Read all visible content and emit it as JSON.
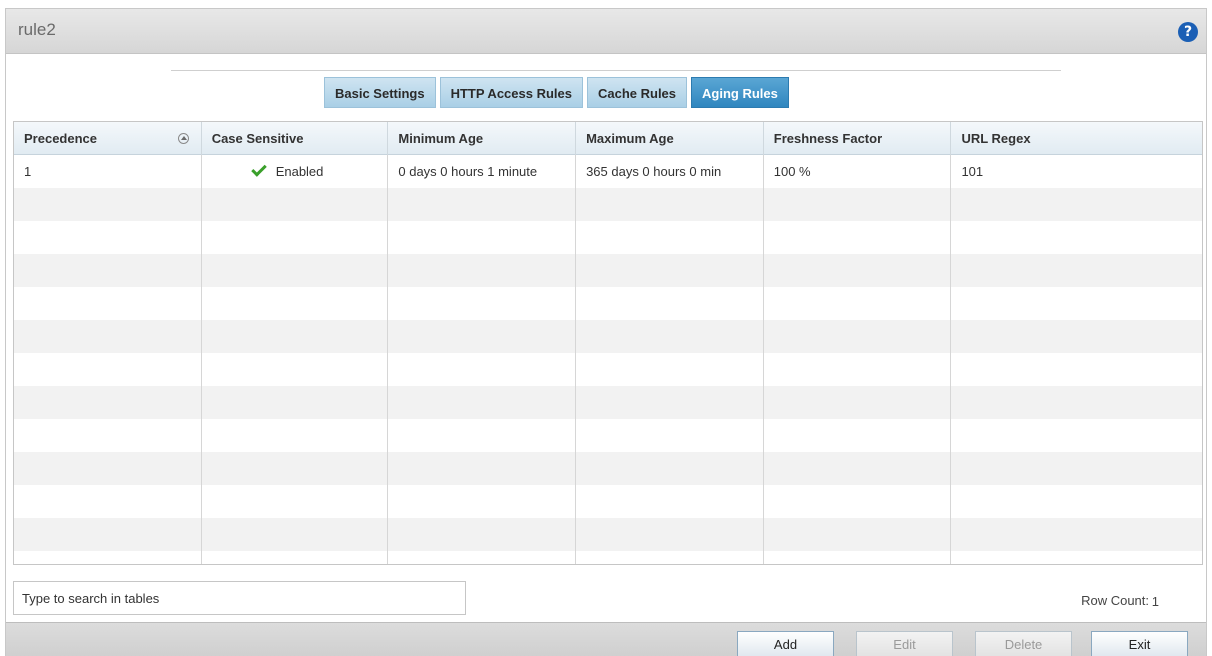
{
  "window": {
    "title": "rule2",
    "help_label": "?"
  },
  "tabs": [
    {
      "label": "Basic Settings",
      "active": false
    },
    {
      "label": "HTTP Access Rules",
      "active": false
    },
    {
      "label": "Cache Rules",
      "active": false
    },
    {
      "label": "Aging Rules",
      "active": true
    }
  ],
  "table": {
    "columns": [
      "Precedence",
      "Case Sensitive",
      "Minimum Age",
      "Maximum Age",
      "Freshness Factor",
      "URL Regex"
    ],
    "rows": [
      {
        "precedence": "1",
        "case_sensitive": "Enabled",
        "minimum_age": "0 days 0 hours 1 minute",
        "maximum_age": "365 days 0 hours 0 min",
        "freshness_factor": "100 %",
        "url_regex": "101"
      }
    ]
  },
  "search": {
    "placeholder": "Type to search in tables"
  },
  "row_count": {
    "label": "Row Count:",
    "value": "1"
  },
  "buttons": {
    "add": "Add",
    "edit": "Edit",
    "delete": "Delete",
    "exit": "Exit"
  },
  "colors": {
    "accent": "#2f86bf",
    "check": "#3aa02b",
    "help": "#1b5fb5"
  }
}
